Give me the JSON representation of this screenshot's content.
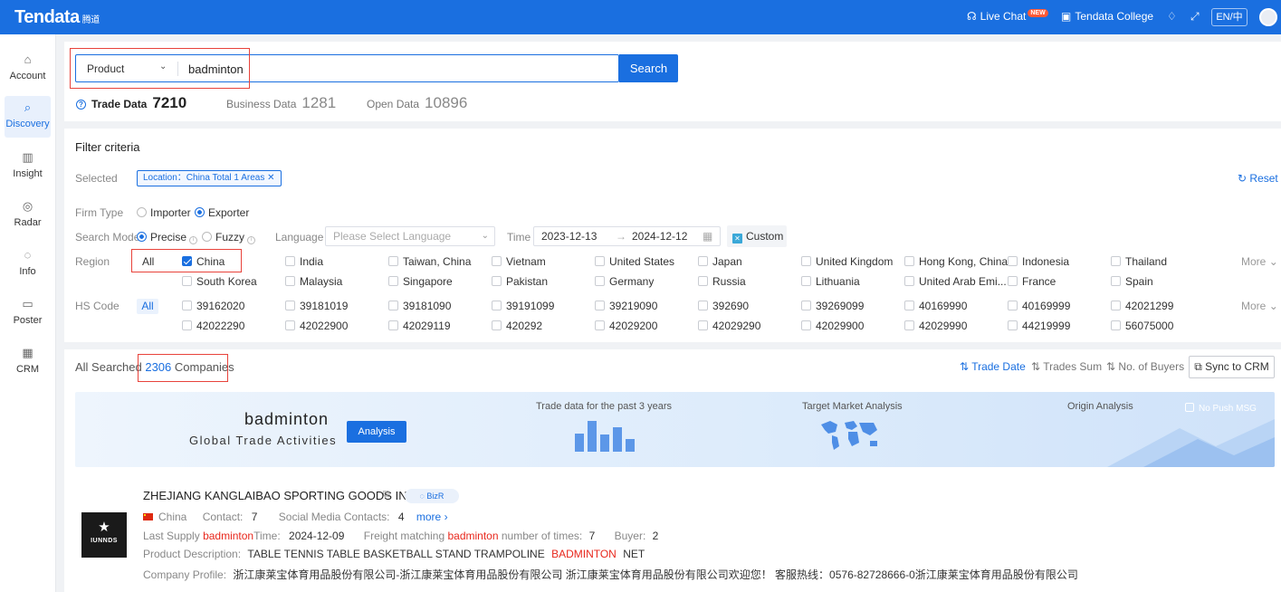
{
  "topbar": {
    "logo": "Tendata",
    "logo_sub": "腾道",
    "live_chat": "Live Chat",
    "new_badge": "NEW",
    "college": "Tendata College",
    "lang": "EN/中"
  },
  "sidebar": {
    "items": [
      {
        "label": "Account"
      },
      {
        "label": "Discovery"
      },
      {
        "label": "Insight"
      },
      {
        "label": "Radar"
      },
      {
        "label": "Info"
      },
      {
        "label": "Poster"
      },
      {
        "label": "CRM"
      }
    ]
  },
  "search": {
    "type": "Product",
    "value": "badminton",
    "button": "Search"
  },
  "data_tabs": [
    {
      "label": "Trade Data",
      "count": "7210"
    },
    {
      "label": "Business Data",
      "count": "1281"
    },
    {
      "label": "Open Data",
      "count": "10896"
    }
  ],
  "filter": {
    "title": "Filter criteria",
    "selected_label": "Selected",
    "location_tag": "Location：China Total 1 Areas",
    "reset": "Reset",
    "firm_type_label": "Firm Type",
    "importer": "Importer",
    "exporter": "Exporter",
    "search_mode_label": "Search Mode",
    "precise": "Precise",
    "fuzzy": "Fuzzy",
    "language_label": "Language",
    "language_placeholder": "Please Select Language",
    "time_label": "Time",
    "date_from": "2023-12-13",
    "date_arrow": "→",
    "date_to": "2024-12-12",
    "custom": "Custom",
    "region_label": "Region",
    "region_all": "All",
    "region_selected": "China",
    "regions_row1": [
      "India",
      "Taiwan, China",
      "Vietnam",
      "United States",
      "Japan",
      "United Kingdom",
      "Hong Kong, China",
      "Indonesia",
      "Thailand"
    ],
    "regions_row2": [
      "South Korea",
      "Malaysia",
      "Singapore",
      "Pakistan",
      "Germany",
      "Russia",
      "Lithuania",
      "United Arab Emi...",
      "France",
      "Spain"
    ],
    "more": "More",
    "hs_label": "HS Code",
    "hs_all": "All",
    "hs_row1": [
      "39162020",
      "39181019",
      "39181090",
      "39191099",
      "39219090",
      "392690",
      "39269099",
      "40169990",
      "40169999",
      "42021299"
    ],
    "hs_row2": [
      "42022290",
      "42022900",
      "42029119",
      "420292",
      "42029200",
      "42029290",
      "42029900",
      "42029990",
      "44219999",
      "56075000"
    ]
  },
  "results": {
    "prefix": "All Searched",
    "count": "2306",
    "suffix": "Companies",
    "sort_trade_date": "Trade Date",
    "sort_trades_sum": "Trades Sum",
    "sort_buyers": "No. of Buyers",
    "sync": "Sync to CRM"
  },
  "banner": {
    "keyword": "badminton",
    "subtitle": "Global Trade Activities",
    "analysis": "Analysis",
    "trade_label": "Trade data for the past 3 years",
    "target_label": "Target Market Analysis",
    "origin_label": "Origin Analysis",
    "no_push": "No Push MSG",
    "bar_values": [
      0.6,
      1.0,
      0.55,
      0.8,
      0.4
    ]
  },
  "company": {
    "logo_text": "IUNNDS",
    "name": "ZHEJIANG KANGLAIBAO SPORTING GOODS INC",
    "bizr": "BizR",
    "country": "China",
    "contact_label": "Contact:",
    "contact": "7",
    "social_label": "Social Media Contacts:",
    "social": "4",
    "more": "more",
    "last_supply_prefix": "Last Supply",
    "kw": "badminton",
    "time_label": "Time:",
    "last_supply_time": "2024-12-09",
    "freight_prefix": "Freight matching",
    "freight_suffix": "number of times:",
    "freight_times": "7",
    "buyer_label": "Buyer:",
    "buyer": "2",
    "desc_label": "Product Description:",
    "desc_text": "TABLE TENNIS TABLE BASKETBALL STAND TRAMPOLINE",
    "desc_kw": "BADMINTON",
    "desc_end": "NET",
    "profile_label": "Company Profile:",
    "profile": "浙江康莱宝体育用品股份有限公司-浙江康莱宝体育用品股份有限公司 浙江康莱宝体育用品股份有限公司欢迎您！ 客服热线：0576-82728666-0浙江康莱宝体育用品股份有限公司"
  }
}
